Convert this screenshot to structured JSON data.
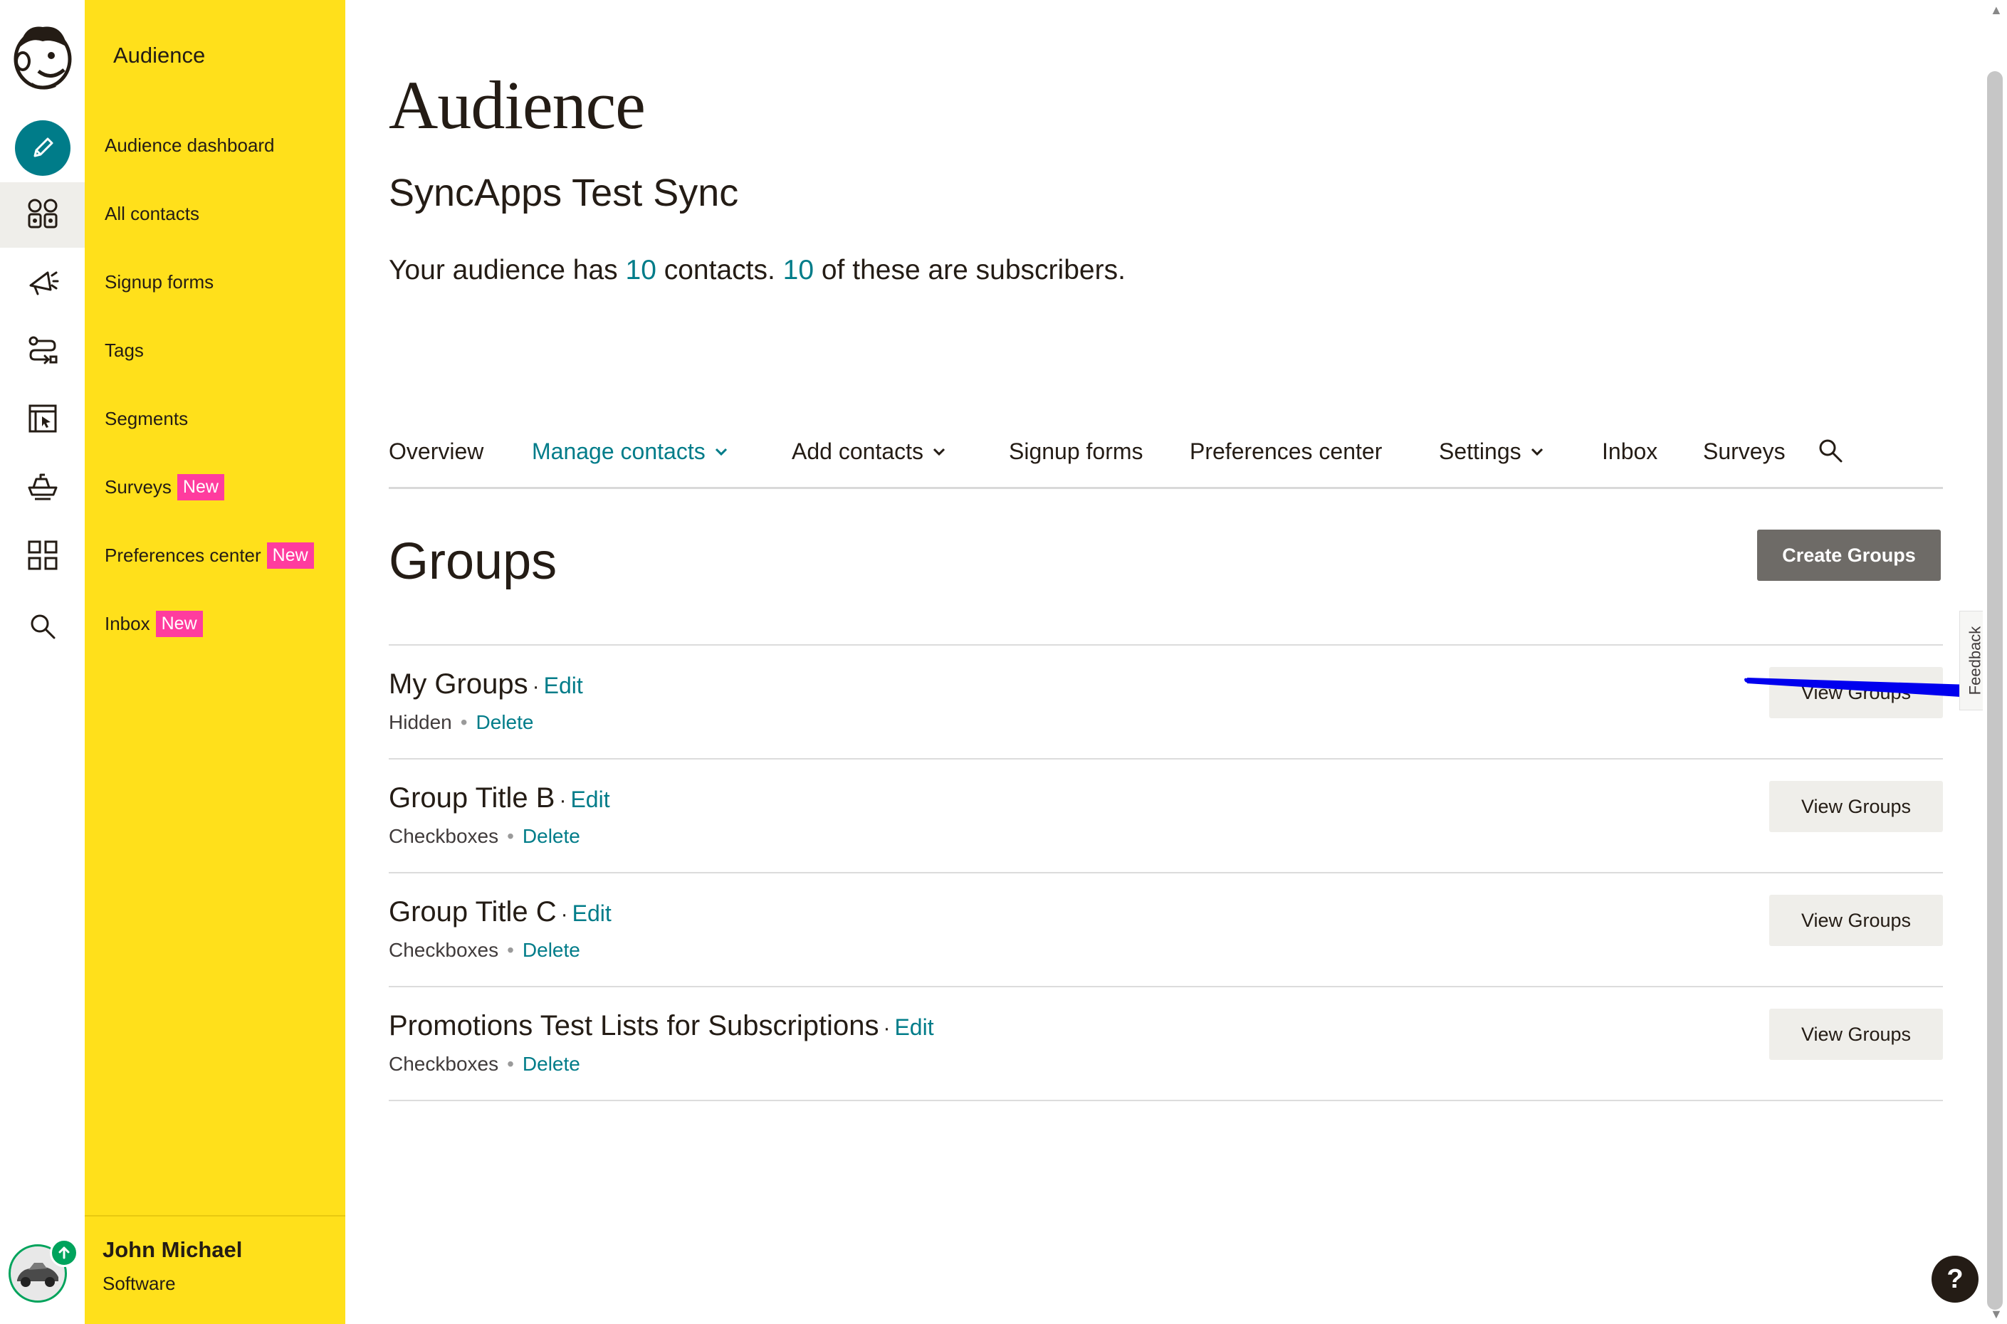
{
  "rail": {
    "items": [
      {
        "name": "create-icon"
      },
      {
        "name": "audience-icon"
      },
      {
        "name": "campaigns-icon"
      },
      {
        "name": "automations-icon"
      },
      {
        "name": "website-icon"
      },
      {
        "name": "integrations-icon"
      },
      {
        "name": "apps-icon"
      },
      {
        "name": "search-icon"
      }
    ],
    "active_color": "#007c89",
    "upgrade_color": "#00a35c"
  },
  "sidebar": {
    "title": "Audience",
    "items": [
      {
        "label": "Audience dashboard"
      },
      {
        "label": "All contacts"
      },
      {
        "label": "Signup forms"
      },
      {
        "label": "Tags"
      },
      {
        "label": "Segments"
      },
      {
        "label": "Surveys",
        "badge": "New"
      },
      {
        "label": "Preferences center",
        "badge": "New"
      },
      {
        "label": "Inbox",
        "badge": "New"
      }
    ],
    "user": {
      "name": "John Michael",
      "org": "Software"
    },
    "bg_color": "#ffe01b",
    "badge_color": "#ff3c9e"
  },
  "main": {
    "title": "Audience",
    "audience_name": "SyncApps Test Sync",
    "summary": {
      "prefix": "Your audience has ",
      "contacts": "10",
      "middle": " contacts. ",
      "subscribers": "10",
      "suffix": " of these are subscribers."
    },
    "tabs": [
      {
        "label": "Overview"
      },
      {
        "label": "Manage contacts",
        "dropdown": true,
        "active": true
      },
      {
        "label": "Add contacts",
        "dropdown": true
      },
      {
        "label": "Signup forms"
      },
      {
        "label": "Preferences center"
      },
      {
        "label": "Settings",
        "dropdown": true
      },
      {
        "label": "Inbox"
      },
      {
        "label": "Surveys"
      }
    ],
    "groups_heading": "Groups",
    "create_button": "Create Groups",
    "groups": [
      {
        "title": "My Groups",
        "edit": "Edit",
        "type": "Hidden",
        "delete": "Delete",
        "view": "View Groups"
      },
      {
        "title": "Group Title B",
        "edit": "Edit",
        "type": "Checkboxes",
        "delete": "Delete",
        "view": "View Groups"
      },
      {
        "title": "Group Title C",
        "edit": "Edit",
        "type": "Checkboxes",
        "delete": "Delete",
        "view": "View Groups"
      },
      {
        "title": "Promotions Test Lists for Subscriptions",
        "edit": "Edit",
        "type": "Checkboxes",
        "delete": "Delete",
        "view": "View Groups"
      }
    ]
  },
  "feedback_label": "Feedback",
  "help_label": "?",
  "annotation_arrow_color": "#0000ee"
}
